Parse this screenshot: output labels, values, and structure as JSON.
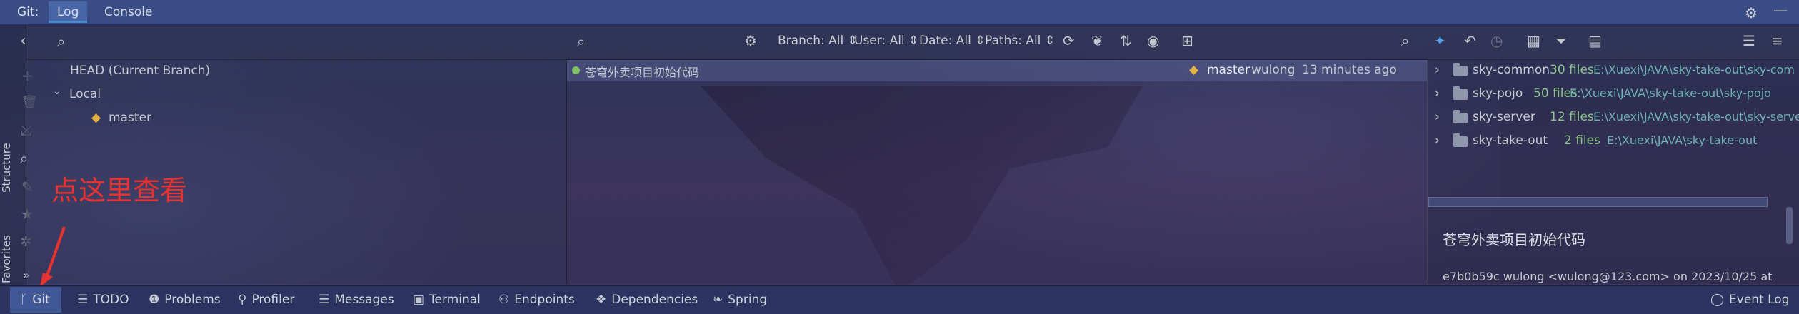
{
  "topbar": {
    "label": "Git:",
    "tabs": [
      {
        "label": "Log"
      },
      {
        "label": "Console"
      }
    ],
    "right_icons": [
      "gear-icon",
      "minimize-icon"
    ]
  },
  "left_strip": {
    "labels": {
      "structure": "Structure",
      "favorites": "Favorites"
    },
    "icons": [
      "back-arrow-icon",
      "add-icon",
      "delete-icon",
      "merge-icon",
      "search-icon",
      "edit-icon",
      "star-icon",
      "settings-wheel-icon",
      "expand-more-icon"
    ]
  },
  "toolbar": {
    "search_placeholder": "",
    "filters": {
      "branch": "Branch: All",
      "user": "User: All",
      "date": "Date: All",
      "paths": "Paths: All"
    }
  },
  "branches": {
    "head": "HEAD (Current Branch)",
    "local_label": "Local",
    "branch": "master"
  },
  "log": {
    "commit": {
      "message": "苍穹外卖项目初始代码",
      "ref": "master",
      "author": "wulong",
      "time": "13 minutes ago"
    }
  },
  "details": {
    "files": [
      {
        "name": "sky-common",
        "count": "30 files",
        "path": "E:\\Xuexi\\JAVA\\sky-take-out\\sky-com"
      },
      {
        "name": "sky-pojo",
        "count": "50 files",
        "path": "E:\\Xuexi\\JAVA\\sky-take-out\\sky-pojo"
      },
      {
        "name": "sky-server",
        "count": "12 files",
        "path": "E:\\Xuexi\\JAVA\\sky-take-out\\sky-server"
      },
      {
        "name": "sky-take-out",
        "count": "2 files",
        "path": "E:\\Xuexi\\JAVA\\sky-take-out"
      }
    ],
    "commit_title": "苍穹外卖项目初始代码",
    "commit_meta": "e7b0b59c wulong <wulong@123.com> on 2023/10/25 at"
  },
  "annotation": "点这里查看",
  "statusbar": {
    "tools": [
      {
        "label": "Git"
      },
      {
        "label": "TODO"
      },
      {
        "label": "Problems"
      },
      {
        "label": "Profiler"
      },
      {
        "label": "Messages"
      },
      {
        "label": "Terminal"
      },
      {
        "label": "Endpoints"
      },
      {
        "label": "Dependencies"
      },
      {
        "label": "Spring"
      }
    ],
    "event_log": "Event Log"
  },
  "colors": {
    "annotation_red": "#e8322f",
    "commit_dot": "#7fbf63",
    "tag_yellow": "#e3b341",
    "path_teal": "#6db2b2",
    "count_green": "#8bc48a"
  }
}
